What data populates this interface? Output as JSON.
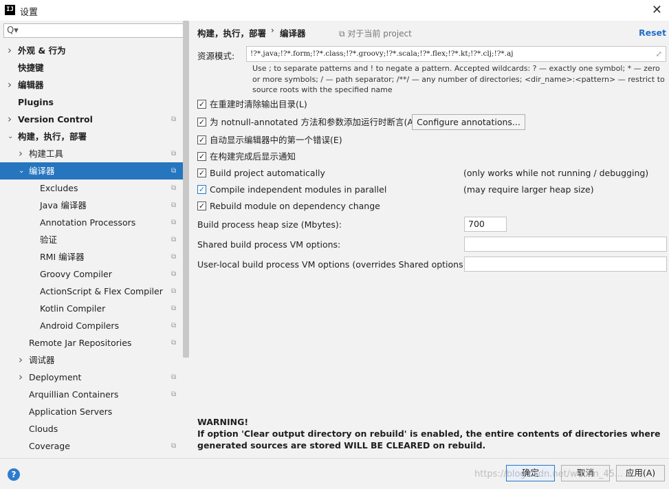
{
  "window": {
    "logo": "IJ",
    "title": "设置",
    "close_icon": "close-icon"
  },
  "search": {
    "placeholder": "Q▾",
    "value": ""
  },
  "tree": [
    {
      "label": "外观 & 行为",
      "level": 0,
      "arrow": "right",
      "bold": true,
      "copy": false
    },
    {
      "label": "快捷键",
      "level": 0,
      "arrow": "",
      "bold": true,
      "copy": false
    },
    {
      "label": "编辑器",
      "level": 0,
      "arrow": "right",
      "bold": true,
      "copy": false
    },
    {
      "label": "Plugins",
      "level": 0,
      "arrow": "",
      "bold": true,
      "copy": false
    },
    {
      "label": "Version Control",
      "level": 0,
      "arrow": "right",
      "bold": true,
      "copy": true
    },
    {
      "label": "构建，执行，部署",
      "level": 0,
      "arrow": "down",
      "bold": true,
      "copy": false
    },
    {
      "label": "构建工具",
      "level": 1,
      "arrow": "right",
      "bold": false,
      "copy": true
    },
    {
      "label": "编译器",
      "level": 1,
      "arrow": "down",
      "bold": false,
      "copy": true,
      "selected": true
    },
    {
      "label": "Excludes",
      "level": 2,
      "arrow": "",
      "bold": false,
      "copy": true
    },
    {
      "label": "Java 编译器",
      "level": 2,
      "arrow": "",
      "bold": false,
      "copy": true
    },
    {
      "label": "Annotation Processors",
      "level": 2,
      "arrow": "",
      "bold": false,
      "copy": true
    },
    {
      "label": "验证",
      "level": 2,
      "arrow": "",
      "bold": false,
      "copy": true
    },
    {
      "label": "RMI 编译器",
      "level": 2,
      "arrow": "",
      "bold": false,
      "copy": true
    },
    {
      "label": "Groovy Compiler",
      "level": 2,
      "arrow": "",
      "bold": false,
      "copy": true
    },
    {
      "label": "ActionScript & Flex Compiler",
      "level": 2,
      "arrow": "",
      "bold": false,
      "copy": true
    },
    {
      "label": "Kotlin Compiler",
      "level": 2,
      "arrow": "",
      "bold": false,
      "copy": true
    },
    {
      "label": "Android Compilers",
      "level": 2,
      "arrow": "",
      "bold": false,
      "copy": true
    },
    {
      "label": "Remote Jar Repositories",
      "level": 1,
      "arrow": "",
      "bold": false,
      "copy": true
    },
    {
      "label": "调试器",
      "level": 1,
      "arrow": "right",
      "bold": false,
      "copy": false
    },
    {
      "label": "Deployment",
      "level": 1,
      "arrow": "right",
      "bold": false,
      "copy": true
    },
    {
      "label": "Arquillian Containers",
      "level": 1,
      "arrow": "",
      "bold": false,
      "copy": true
    },
    {
      "label": "Application Servers",
      "level": 1,
      "arrow": "",
      "bold": false,
      "copy": false
    },
    {
      "label": "Clouds",
      "level": 1,
      "arrow": "",
      "bold": false,
      "copy": false
    },
    {
      "label": "Coverage",
      "level": 1,
      "arrow": "",
      "bold": false,
      "copy": true
    }
  ],
  "main": {
    "breadcrumb_parent": "构建，执行，部署",
    "breadcrumb_sep": "›",
    "breadcrumb_current": "编译器",
    "project_scope": "⧉ 对于当前 project",
    "reset": "Reset",
    "resource_label": "资源模式:",
    "resource_value": "!?*.java;!?*.form;!?*.class;!?*.groovy;!?*.scala;!?*.flex;!?*.kt;!?*.clj;!?*.aj",
    "hint": "Use ; to separate patterns and ! to negate a pattern. Accepted wildcards: ? — exactly one symbol; * — zero or more symbols; / — path separator; /**/ — any number of directories; <dir_name>:<pattern> — restrict to source roots with the specified name",
    "checkboxes": [
      {
        "label": "在重建时清除输出目录(L)",
        "checked": true,
        "note": ""
      },
      {
        "label": "为 notnull-annotated 方法和参数添加运行时断言(A)",
        "checked": true,
        "note": ""
      },
      {
        "label": "自动显示编辑器中的第一个错误(E)",
        "checked": true,
        "note": ""
      },
      {
        "label": "在构建完成后显示通知",
        "checked": true,
        "note": ""
      },
      {
        "label": "Build project automatically",
        "checked": true,
        "note": "(only works while not running / debugging)"
      },
      {
        "label": "Compile independent modules in parallel",
        "checked": true,
        "note": "(may require larger heap size)"
      },
      {
        "label": "Rebuild module on dependency change",
        "checked": true,
        "note": ""
      }
    ],
    "configure_button": "Configure annotations...",
    "heap_label": "Build process heap size (Mbytes):",
    "heap_value": "700",
    "shared_vm_label": "Shared build process VM options:",
    "shared_vm_value": "",
    "user_vm_label": "User-local build process VM options (overrides Shared options):",
    "user_vm_value": "",
    "warning_title": "WARNING!",
    "warning_text": "If option 'Clear output directory on rebuild' is enabled, the entire contents of directories where generated sources are stored WILL BE CLEARED on rebuild."
  },
  "footer": {
    "help": "?",
    "ok": "确定",
    "cancel": "取消",
    "apply": "应用(A)",
    "watermark": "https://blog.csdn.net/weixin_45..."
  }
}
